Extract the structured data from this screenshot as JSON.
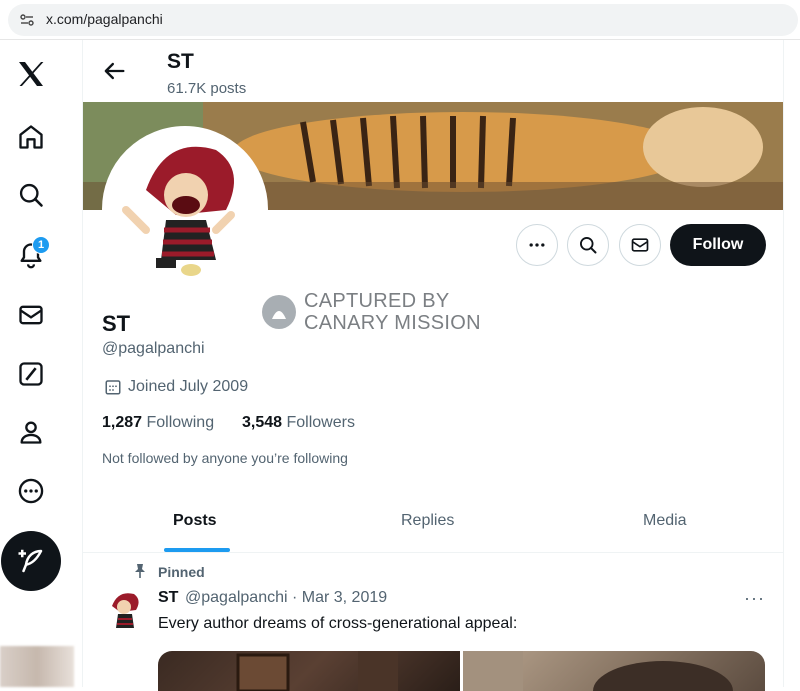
{
  "browser": {
    "url": "x.com/pagalpanchi"
  },
  "nav": {
    "items": [
      "X logo",
      "Home",
      "Explore",
      "Notifications",
      "Messages",
      "Grok",
      "Profile",
      "More"
    ],
    "notification_count": "1"
  },
  "header": {
    "name": "ST",
    "posts": "61.7K posts"
  },
  "profile": {
    "name": "ST",
    "handle": "@pagalpanchi",
    "joined": "Joined July 2009",
    "following_count": "1,287",
    "following_label": "Following",
    "followers_count": "3,548",
    "followers_label": "Followers",
    "not_followed": "Not followed by anyone you’re following",
    "follow_label": "Follow"
  },
  "watermark": {
    "line1": "CAPTURED BY",
    "line2": "CANARY MISSION"
  },
  "tabs": [
    "Posts",
    "Replies",
    "Media"
  ],
  "pinned_post": {
    "pinned_label": "Pinned",
    "author": "ST",
    "meta": "@pagalpanchi · Mar 3, 2019",
    "more": "···",
    "text": "Every author dreams of cross-generational appeal:"
  },
  "colors": {
    "accent": "#1d9bf0",
    "text": "#0f1419",
    "muted": "#536471",
    "follow_bg": "#0f1419"
  }
}
